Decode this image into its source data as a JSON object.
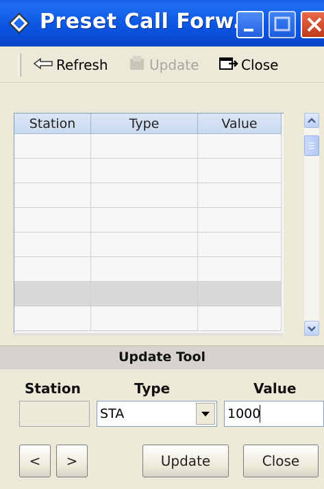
{
  "window": {
    "title": "Preset Call Forw..."
  },
  "toolbar": {
    "refresh_label": "Refresh",
    "update_label": "Update",
    "close_label": "Close"
  },
  "grid": {
    "columns": [
      "Station",
      "Type",
      "Value"
    ],
    "rows": 8,
    "selected_row_index": 6
  },
  "update_tool": {
    "title": "Update Tool",
    "station_label": "Station",
    "type_label": "Type",
    "value_label": "Value",
    "station_value": "",
    "type_value": "STA",
    "value_value": "1000",
    "prev_label": "<",
    "next_label": ">",
    "update_button": "Update",
    "close_button": "Close"
  },
  "colors": {
    "titlebar": "#0a54e0",
    "grid_header": "#c9daf0",
    "selected_row": "#d8d8d8"
  },
  "icons": [
    "preset-diamond-icon",
    "minimize-icon",
    "maximize-icon",
    "close-icon",
    "refresh-arrow-icon",
    "update-icon",
    "close-window-icon",
    "scroll-up-icon",
    "scroll-down-icon",
    "dropdown-arrow-icon"
  ]
}
